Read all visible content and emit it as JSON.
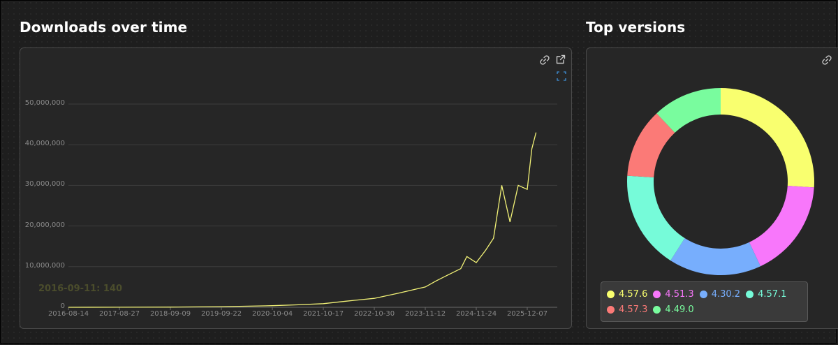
{
  "downloads": {
    "title": "Downloads over time",
    "hover_label": "2016-09-11: 140",
    "line_color": "#f2f277",
    "icons": [
      "link-icon",
      "external-link-icon",
      "zoom-reset-icon"
    ]
  },
  "versions": {
    "title": "Top versions",
    "icons": [
      "link-icon"
    ]
  },
  "chart_data": [
    {
      "type": "line",
      "title": "Downloads over time",
      "ylim": [
        0,
        50000000
      ],
      "y_ticks": [
        "0",
        "10,000,000",
        "20,000,000",
        "30,000,000",
        "40,000,000",
        "50,000,000"
      ],
      "x_ticks": [
        "2016-08-14",
        "2017-08-27",
        "2018-09-09",
        "2019-09-22",
        "2020-10-04",
        "2021-10-17",
        "2022-10-30",
        "2023-11-12",
        "2024-11-24",
        "2025-12-07"
      ],
      "grid": true,
      "series": [
        {
          "x": [
            "2016-08-14",
            "2017-08-27",
            "2018-09-09",
            "2019-09-22",
            "2020-10-04",
            "2021-04-01",
            "2021-10-17",
            "2022-04-01",
            "2022-10-30",
            "2023-05-01",
            "2023-11-12",
            "2024-02-01",
            "2024-05-01",
            "2024-08-01",
            "2024-09-15",
            "2024-11-24",
            "2025-02-01",
            "2025-04-01",
            "2025-06-01",
            "2025-08-01",
            "2025-10-01",
            "2025-12-07",
            "2026-01-10",
            "2026-02-10"
          ],
          "values": [
            140,
            20000,
            60000,
            150000,
            400000,
            600000,
            900000,
            1500000,
            2200000,
            3500000,
            5000000,
            6500000,
            8000000,
            9500000,
            12500000,
            11000000,
            14000000,
            17000000,
            30000000,
            21000000,
            30000000,
            29000000,
            39000000,
            43000000
          ]
        }
      ]
    },
    {
      "type": "pie",
      "title": "Top versions",
      "categories": [
        "4.57.6",
        "4.51.3",
        "4.30.2",
        "4.57.1",
        "4.57.3",
        "4.49.0"
      ],
      "values": [
        26,
        17,
        16,
        17,
        12,
        12
      ],
      "colors": [
        "#f9ff6f",
        "#f877fb",
        "#77aefd",
        "#76fbd9",
        "#fb7a77",
        "#79fc9e"
      ]
    }
  ]
}
